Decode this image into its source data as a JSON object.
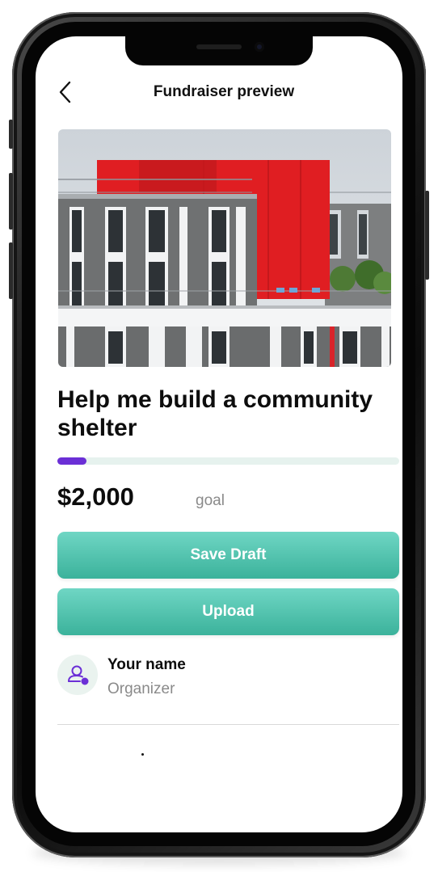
{
  "header": {
    "title": "Fundraiser preview",
    "back_icon": "chevron-left-icon"
  },
  "fundraiser": {
    "title": "Help me build a community shelter",
    "amount": "$2,000",
    "amount_label": "goal",
    "progress_fraction": 0.085
  },
  "actions": {
    "save_label": "Save Draft",
    "upload_label": "Upload"
  },
  "organizer": {
    "name": "Your name",
    "role": "Organizer",
    "avatar_icon": "user-icon"
  },
  "colors": {
    "accent": "#6b2fd6",
    "button_top": "#6fd6c4",
    "button_bottom": "#3bb29b",
    "track": "#e6f2ee"
  }
}
